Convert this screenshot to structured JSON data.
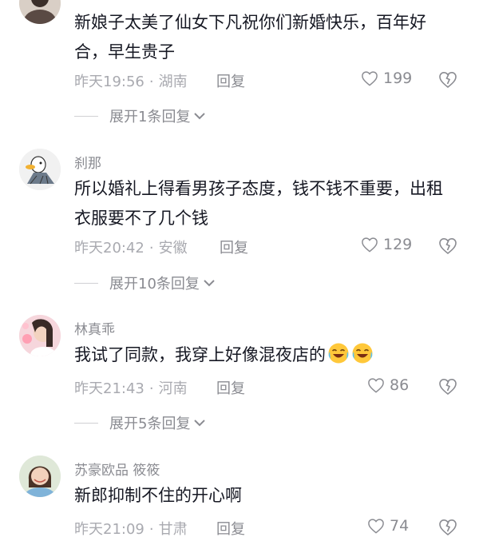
{
  "comments": [
    {
      "username": "",
      "text": "新娘子太美了仙女下凡祝你们新婚快乐，百年好合，早生贵子",
      "time": "昨天19:56",
      "location": "湖南",
      "reply_label": "回复",
      "likes": "199",
      "expand_label": "展开1条回复"
    },
    {
      "username": "刹那",
      "text": "所以婚礼上得看男孩子态度，钱不钱不重要，出租衣服要不了几个钱",
      "time": "昨天20:42",
      "location": "安徽",
      "reply_label": "回复",
      "likes": "129",
      "expand_label": "展开10条回复"
    },
    {
      "username": "林真乖",
      "text": "我试了同款，我穿上好像混夜店的",
      "emoji": "laughing-crying-emoji",
      "time": "昨天21:43",
      "location": "河南",
      "reply_label": "回复",
      "likes": "86",
      "expand_label": "展开5条回复"
    },
    {
      "username": "苏豪欧品 筱筱",
      "text": "新郎抑制不住的开心啊",
      "time": "昨天21:09",
      "location": "甘肃",
      "reply_label": "回复",
      "likes": "74"
    }
  ],
  "separator": "·",
  "colors": {
    "text": "#161823",
    "meta": "#a9aab0",
    "secondary": "#8a8b91"
  }
}
